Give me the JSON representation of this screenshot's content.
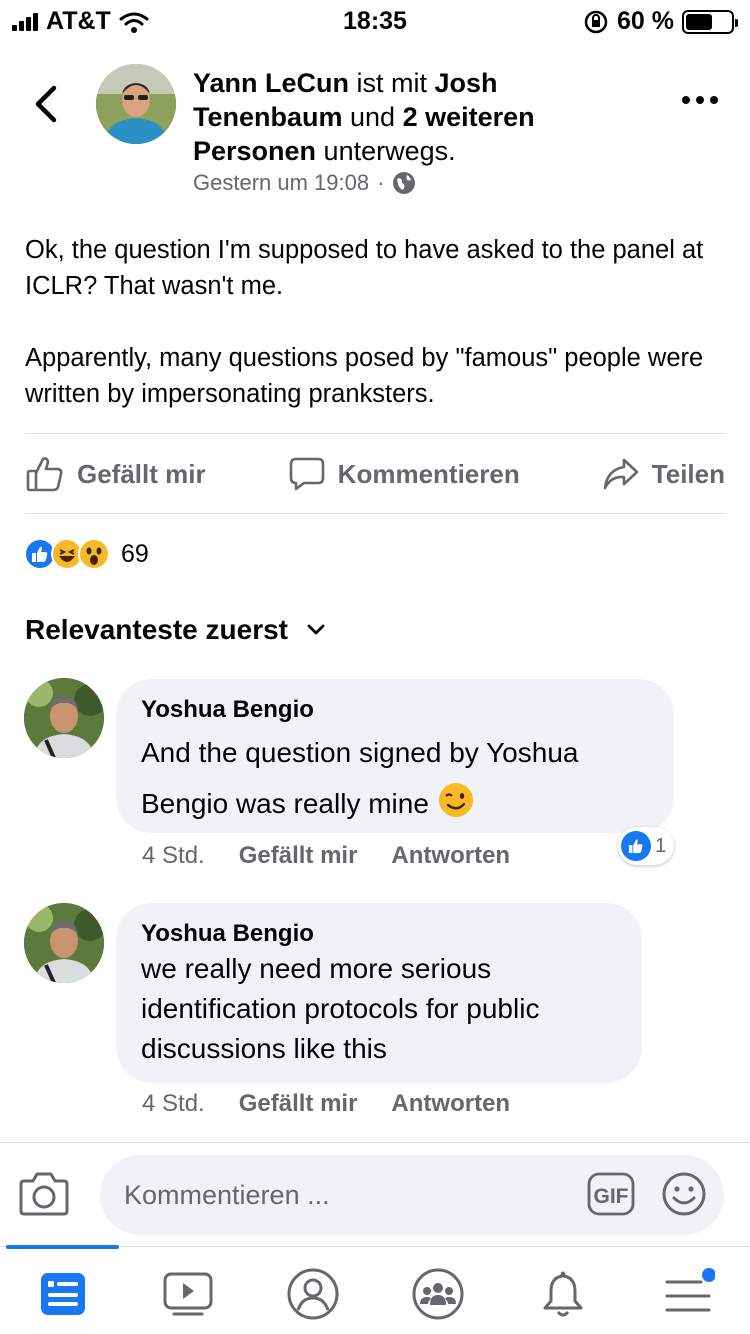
{
  "status_bar": {
    "carrier": "AT&T",
    "time": "18:35",
    "battery": "60 %",
    "battery_level": 0.6
  },
  "post": {
    "author": "Yann LeCun",
    "connector_1": " ist mit ",
    "tagged_person": "Josh Tenenbaum",
    "connector_2": " und ",
    "others": "2 weiteren Personen",
    "activity": " unterwegs.",
    "timestamp": "Gestern um 19:08",
    "separator": "·",
    "paragraphs": [
      "Ok, the question I'm supposed to have asked to the panel at ICLR? That wasn't me.",
      "Apparently, many questions posed by \"famous\" people were written by impersonating pranksters."
    ]
  },
  "actions": {
    "like": "Gefällt mir",
    "comment": "Kommentieren",
    "share": "Teilen"
  },
  "reactions": {
    "types": [
      "like-icon",
      "haha-icon",
      "wow-icon"
    ],
    "count": "69"
  },
  "sort": {
    "label": "Relevanteste zuerst"
  },
  "comments": [
    {
      "author": "Yoshua Bengio",
      "text": "And the question signed by Yoshua Bengio was really mine",
      "time": "4 Std.",
      "like": "Gefällt mir",
      "reply": "Antworten",
      "like_count": "1"
    },
    {
      "author": "Yoshua Bengio",
      "text": "we really need more serious identification protocols for public discussions like this",
      "time": "4 Std.",
      "like": "Gefällt mir",
      "reply": "Antworten"
    }
  ],
  "composer": {
    "placeholder": "Kommentieren ...",
    "gif_label": "GIF"
  },
  "colors": {
    "accent": "#1877f2",
    "secondary_text": "#65676b",
    "bubble": "#f0f2f5"
  }
}
